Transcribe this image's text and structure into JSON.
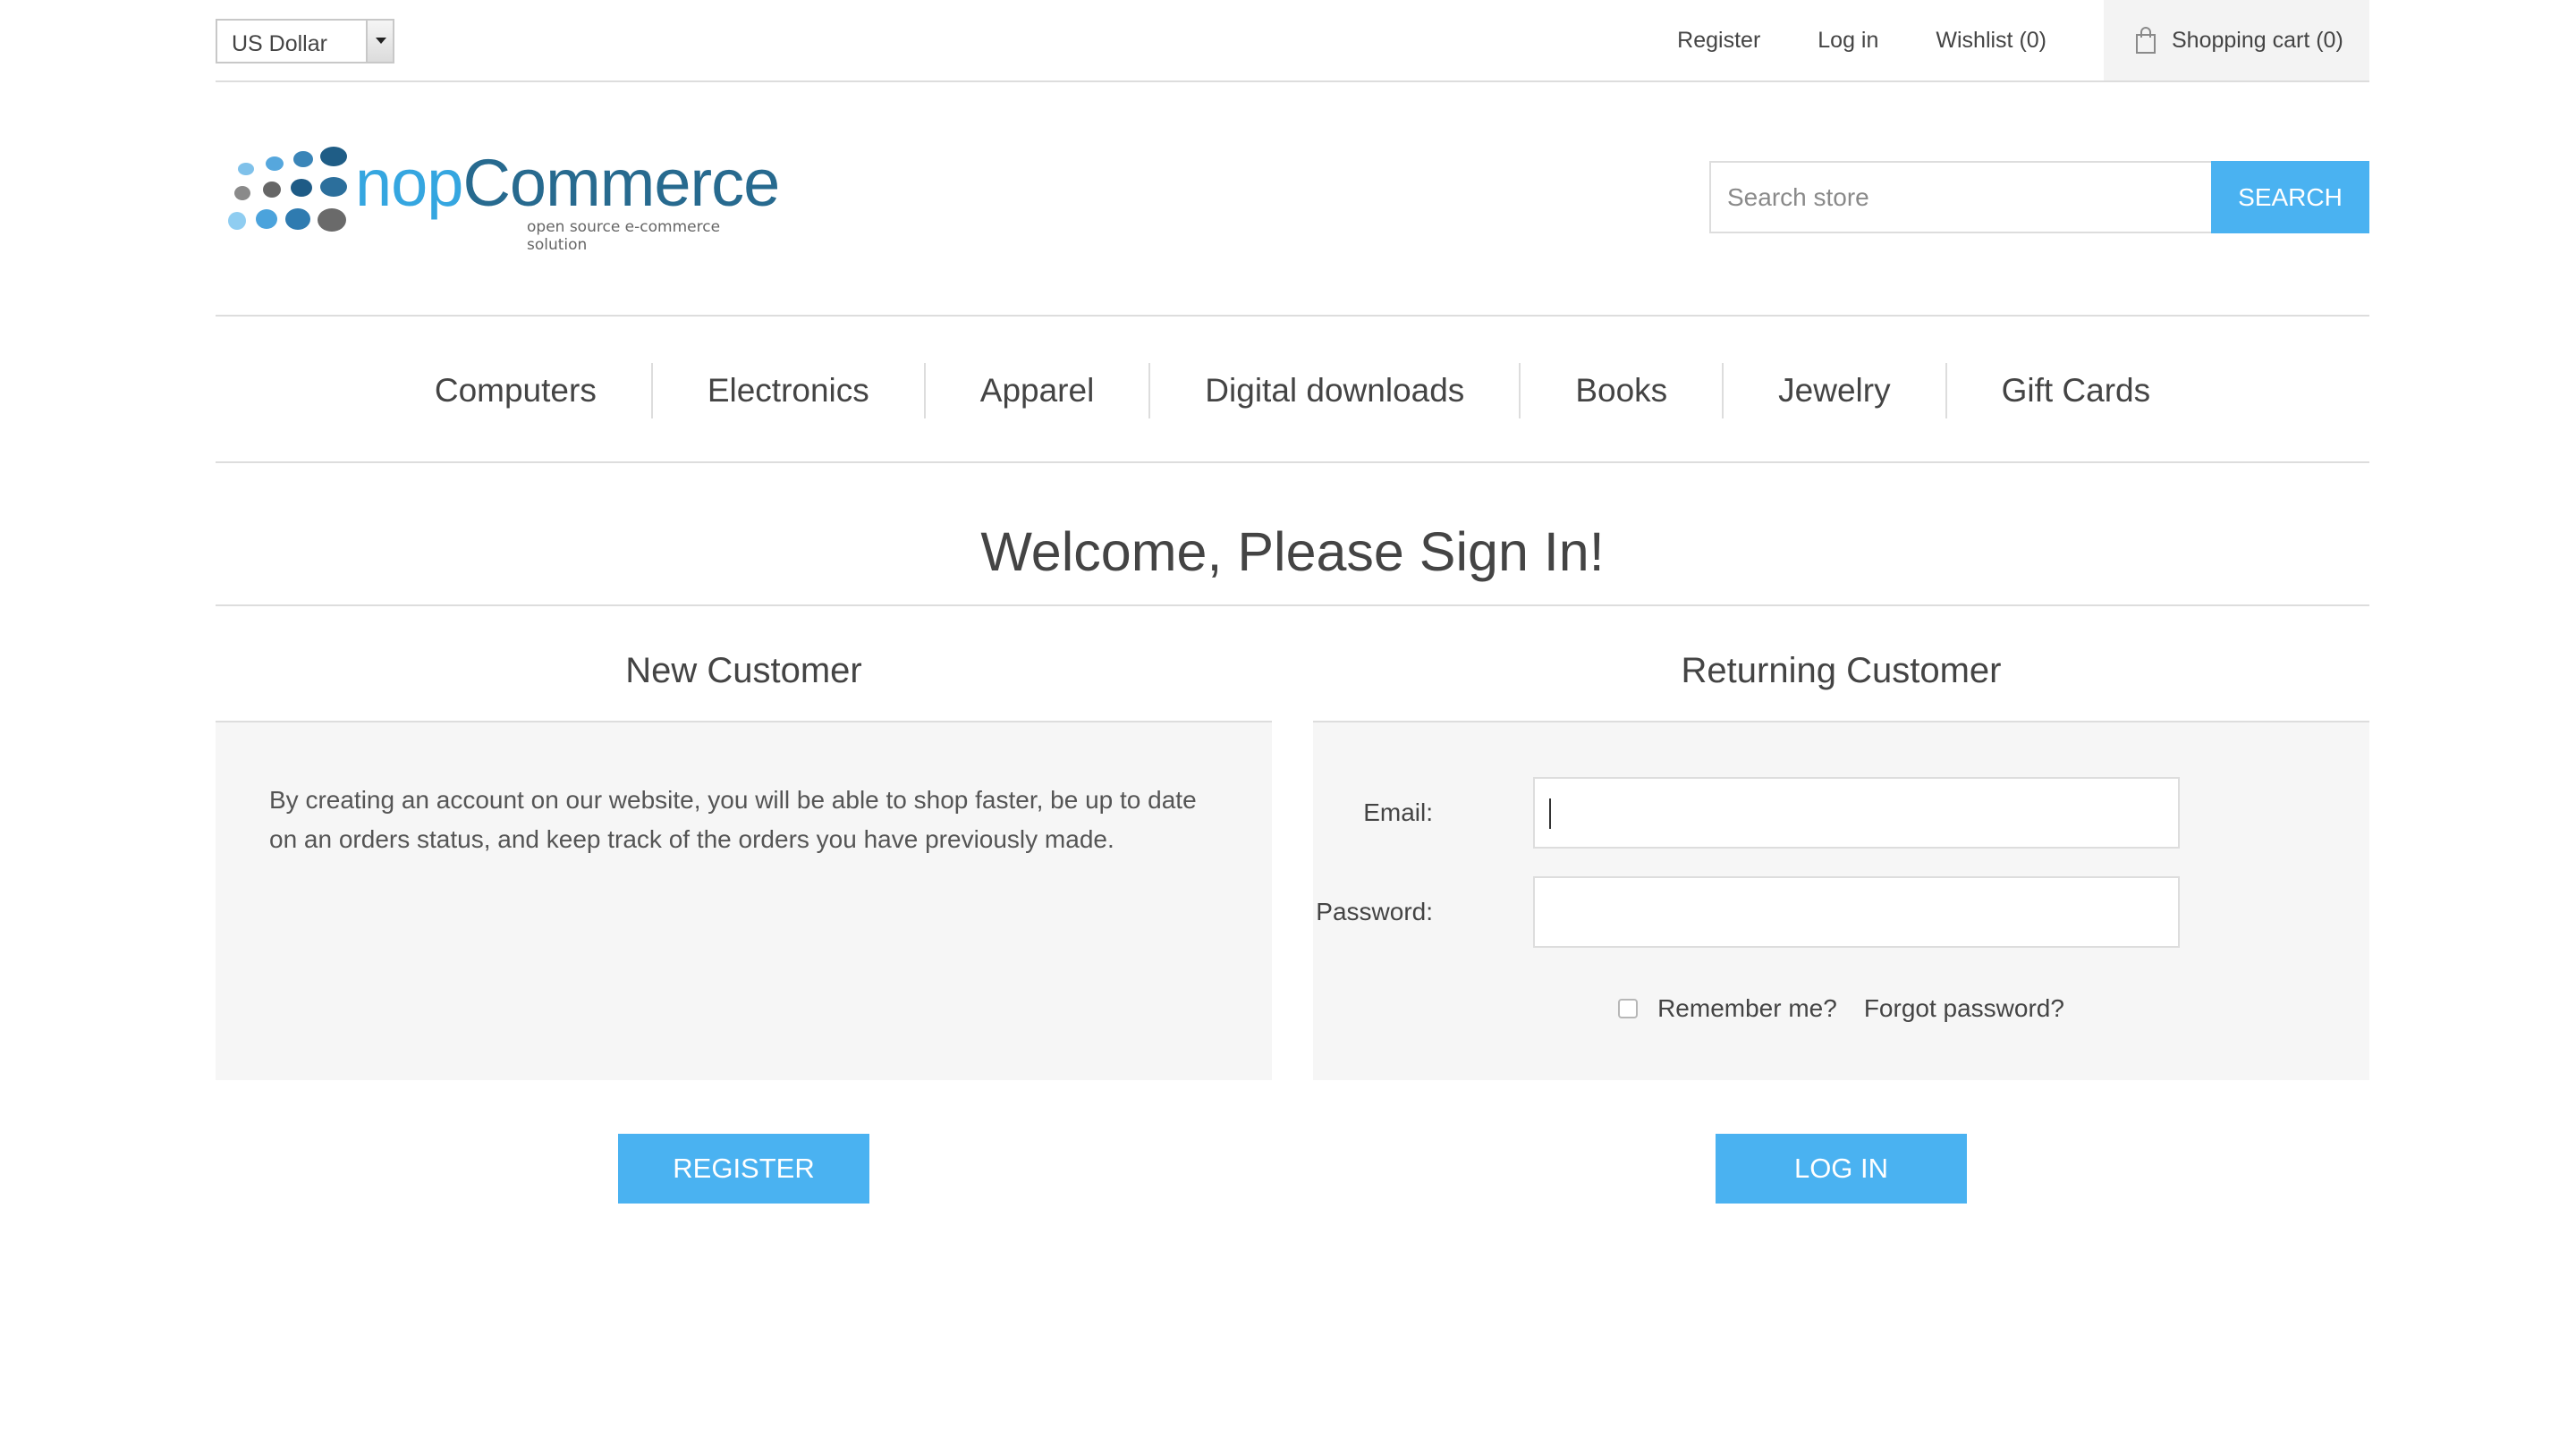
{
  "header": {
    "currency": "US Dollar",
    "links": {
      "register": "Register",
      "login": "Log in",
      "wishlist": "Wishlist (0)",
      "cart": "Shopping cart (0)"
    }
  },
  "logo": {
    "nop": "nop",
    "commerce": "Commerce",
    "tagline": "open source e-commerce solution"
  },
  "search": {
    "placeholder": "Search store",
    "button": "SEARCH"
  },
  "nav": {
    "items": [
      "Computers",
      "Electronics",
      "Apparel",
      "Digital downloads",
      "Books",
      "Jewelry",
      "Gift Cards"
    ]
  },
  "page": {
    "title": "Welcome, Please Sign In!"
  },
  "new_customer": {
    "title": "New Customer",
    "text": "By creating an account on our website, you will be able to shop faster, be up to date on an orders status, and keep track of the orders you have previously made.",
    "button": "REGISTER"
  },
  "returning_customer": {
    "title": "Returning Customer",
    "email_label": "Email:",
    "email_value": "",
    "password_label": "Password:",
    "password_value": "",
    "remember_label": "Remember me?",
    "remember_checked": false,
    "forgot_label": "Forgot password?",
    "button": "LOG IN"
  },
  "colors": {
    "accent": "#4ab2f1",
    "border": "#dddddd",
    "panel_bg": "#f6f6f6",
    "text": "#444444"
  }
}
